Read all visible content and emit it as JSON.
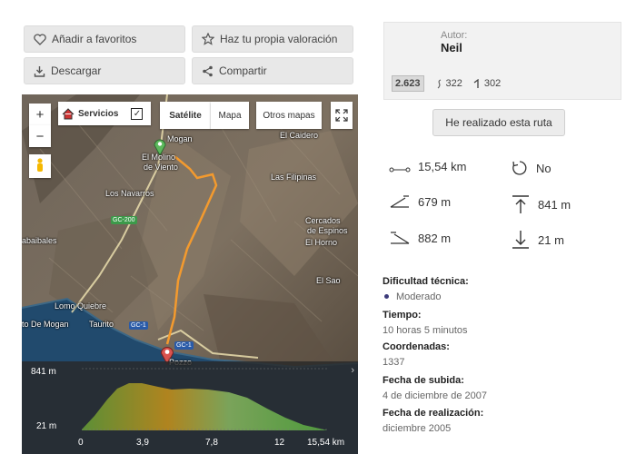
{
  "actions": {
    "favorites_label": "Añadir a favoritos",
    "rating_label": "Haz tu propia valoración",
    "download_label": "Descargar",
    "share_label": "Compartir"
  },
  "author": {
    "label": "Autor:",
    "name": "Neil",
    "stats": {
      "score": "2.623",
      "value_a": "322",
      "value_b": "302"
    }
  },
  "done_button": "He realizado esta ruta",
  "route_stats": {
    "distance": "15,54 km",
    "loop": "No",
    "uphill": "679 m",
    "max_altitude": "841 m",
    "downhill": "882 m",
    "min_altitude": "21 m"
  },
  "info": {
    "difficulty_label": "Dificultad técnica:",
    "difficulty_value": "Moderado",
    "time_label": "Tiempo:",
    "time_value": "10 horas 5 minutos",
    "coords_label": "Coordenadas:",
    "coords_value": "1337",
    "upload_label": "Fecha de subida:",
    "upload_value": "4 de diciembre de 2007",
    "realization_label": "Fecha de realización:",
    "realization_value": "diciembre 2005"
  },
  "map": {
    "zoom_in": "+",
    "zoom_out": "−",
    "services_label": "Servicios",
    "tab_satellite": "Satélite",
    "tab_map": "Mapa",
    "other_maps": "Otros mapas",
    "places": {
      "mogan": "Mogan",
      "molino": "El Molino",
      "viento": "de Viento",
      "caidero": "El Caidero",
      "filipinas": "Las Filipinas",
      "navarros": "Los Navarros",
      "cercados": "Cercados",
      "espinos": "de Espinos",
      "horno": "El Horno",
      "sao": "El Sao",
      "tabaibales": "abaibales",
      "quiebre": "Lomo Quiebre",
      "puerto": "to De Mogan",
      "taurito": "Taurito",
      "pozzo": "Pozzo"
    },
    "roads": {
      "gc200": "GC-200",
      "gc1a": "GC-1",
      "gc1b": "GC-1"
    },
    "colors": {
      "route": "#f39a2e",
      "road": "#f3e6b3",
      "sea": "#214a6d"
    }
  },
  "profile": {
    "y_max": "841 m",
    "y_min": "21 m",
    "x_ticks": [
      "0",
      "3,9",
      "7,8",
      "12",
      "15,54 km"
    ]
  }
}
